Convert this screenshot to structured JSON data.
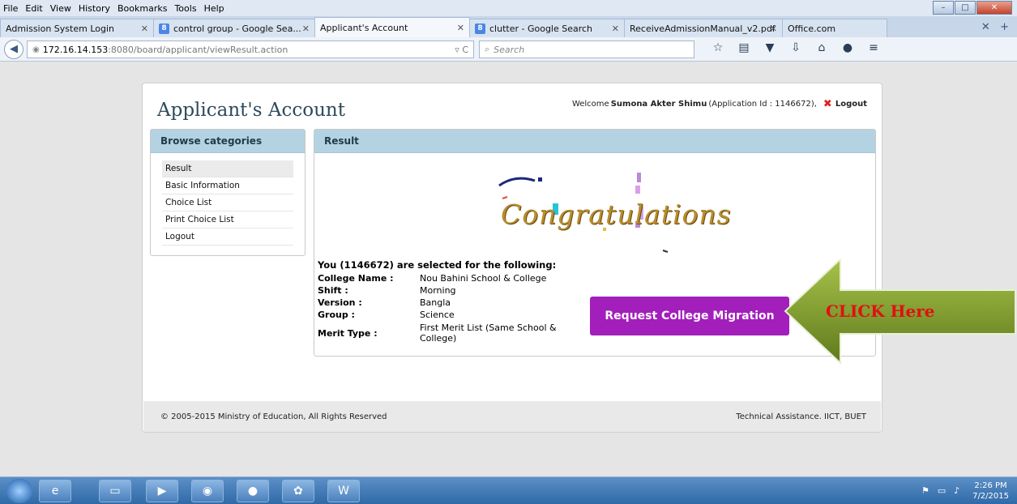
{
  "browser": {
    "menu": [
      "File",
      "Edit",
      "View",
      "History",
      "Bookmarks",
      "Tools",
      "Help"
    ],
    "tabs": [
      {
        "label": "Admission System Login"
      },
      {
        "label": "control group - Google Sea..."
      },
      {
        "label": "Applicant's Account"
      },
      {
        "label": "clutter - Google Search"
      },
      {
        "label": "ReceiveAdmissionManual_v2.pdf"
      },
      {
        "label": "Office.com"
      }
    ],
    "url_host": "172.16.14.153",
    "url_path": ":8080/board/applicant/viewResult.action",
    "search_placeholder": "Search"
  },
  "page": {
    "title": "Applicant's Account",
    "welcome_prefix": "Welcome",
    "user_name": "Sumona Akter Shimu",
    "app_id_text": "(Application Id : 1146672),",
    "logout": "Logout",
    "sidebar": {
      "heading": "Browse categories",
      "items": [
        "Result",
        "Basic Information",
        "Choice List",
        "Print Choice List",
        "Logout"
      ]
    },
    "result": {
      "heading": "Result",
      "congrats": "Congratulations",
      "lead": "You (1146672) are selected for the following:",
      "rows": [
        {
          "k": "College Name :",
          "v": "Nou Bahini School & College"
        },
        {
          "k": "Shift :",
          "v": "Morning"
        },
        {
          "k": "Version :",
          "v": "Bangla"
        },
        {
          "k": "Group :",
          "v": "Science"
        },
        {
          "k": "Merit Type :",
          "v": "First Merit List (Same School & College)"
        }
      ],
      "migrate_button": "Request College Migration"
    },
    "footer_left": "© 2005-2015 Ministry of Education, All Rights Reserved",
    "footer_right": "Technical Assistance. IICT, BUET",
    "callout": "CLICK Here"
  },
  "taskbar": {
    "time": "2:26 PM",
    "date": "7/2/2015"
  },
  "colors": {
    "panel_header": "#b3d3e2",
    "migrate_button": "#a21fbb",
    "callout_arrow": "#7a9a2a",
    "callout_text": "#e01010"
  }
}
